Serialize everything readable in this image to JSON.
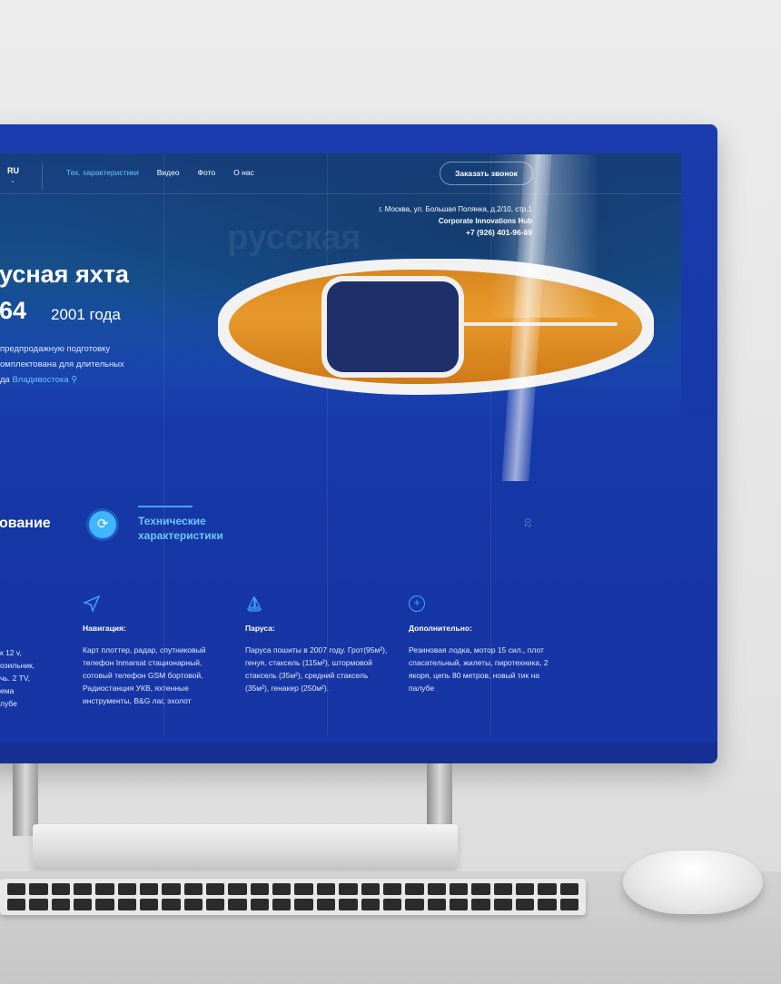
{
  "header": {
    "lang": "RU",
    "nav": [
      "Тех. характеристики",
      "Видео",
      "Фото",
      "О нас"
    ],
    "cta": "Заказать звонок",
    "address": "г. Москва, ул. Большая Полянка, д.2/10, стр.1",
    "company": "Corporate Innovations Hub",
    "phone": "+7 (926) 401-96-69"
  },
  "hero": {
    "ghost": "русская",
    "title": "усная яхта",
    "model": "64",
    "year": "2001 года",
    "desc": [
      "предпродажную подготовку",
      "омплектована для длительных",
      "да"
    ],
    "city": "Владивостока"
  },
  "section": {
    "left": "ование",
    "right": "Технические характеристики",
    "number": "02"
  },
  "features": [
    {
      "icon": "navigation-icon",
      "title": "Навигация:",
      "body": "Карт плоттер, радар, спутниковый телефон Inmarsat стационарный, сотовый телефон GSM бортовой, Радиостанция УКВ, яхтенные инструменты, B&G лаг, эхолот"
    },
    {
      "icon": "sailboat-icon",
      "title": "Паруса:",
      "body": "Паруса пошиты в 2007 году. Грот(95м²), генуя, стаксель (115м²), штормовой стаксель (35м²), средний стаксель (35м²), генакер (250м²)."
    },
    {
      "icon": "plus-circle-icon",
      "title": "Дополнительно:",
      "body": "Резиновая лодка, мотор 15 сил., плот спасательный, жилеты, пиротехника, 2 якоря, цепь 80 метров, новый тик на палубе"
    }
  ],
  "partial_left": [
    "к 12 v,",
    "озильник,",
    "чь. 2 TV,",
    "ема",
    "лубе"
  ],
  "colors": {
    "accent": "#3fa8ff",
    "screen": "#1639a9",
    "link": "#64c5ff"
  }
}
